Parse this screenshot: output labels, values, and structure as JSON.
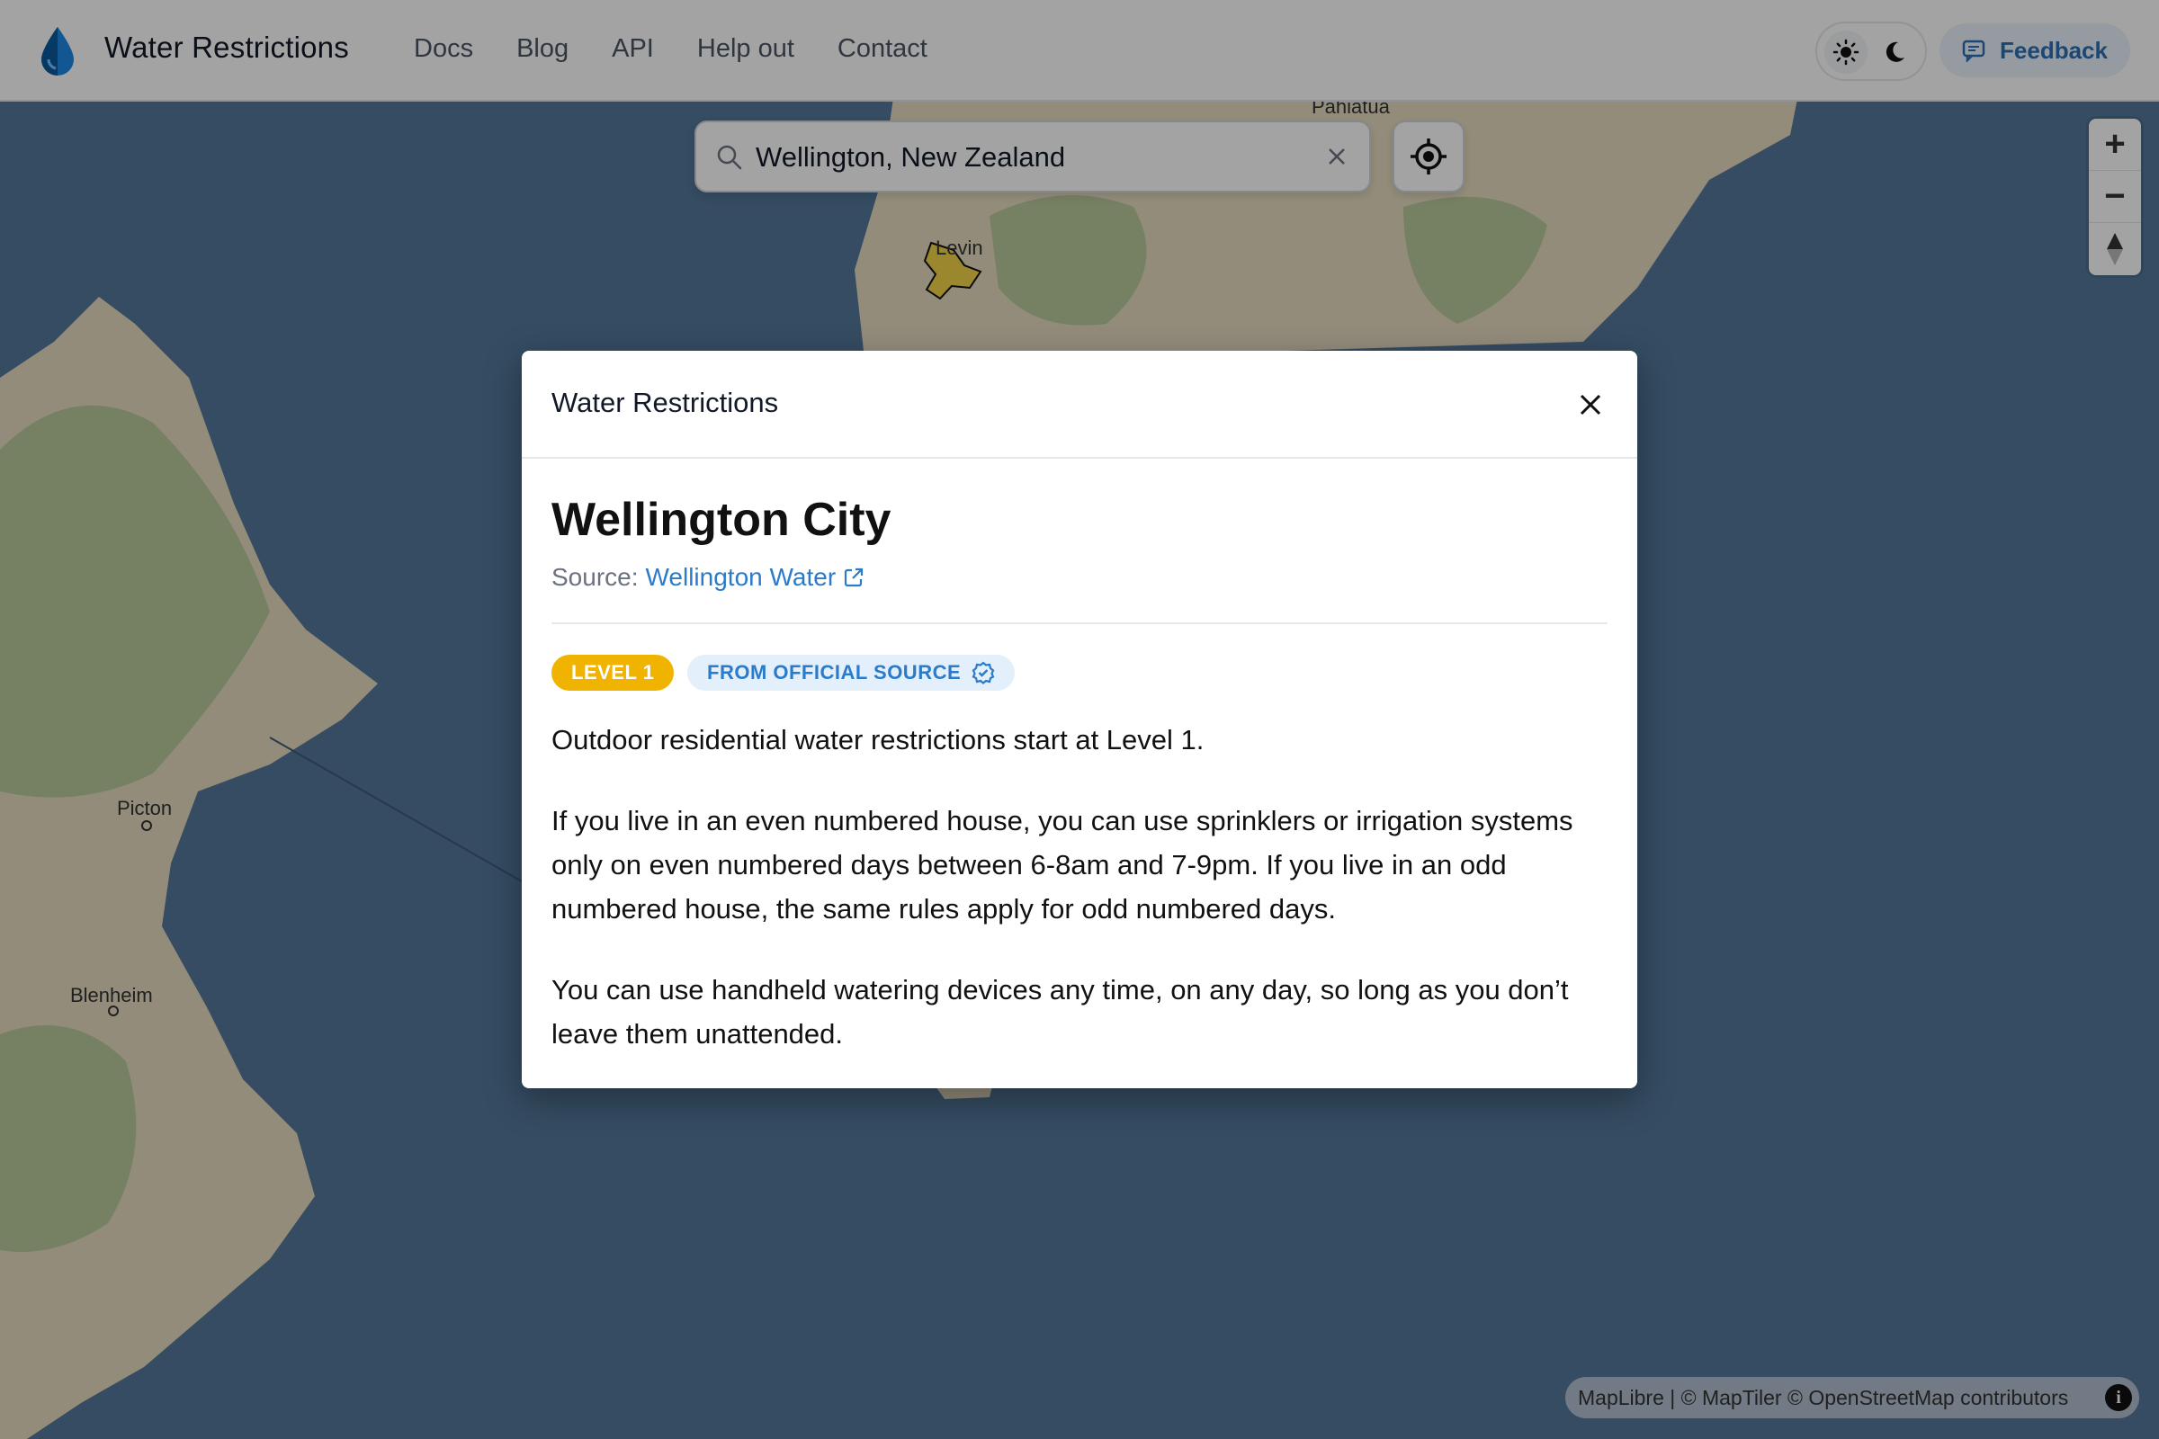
{
  "header": {
    "app_title": "Water Restrictions",
    "logo_icon": "water-drop-icon",
    "nav": [
      "Docs",
      "Blog",
      "API",
      "Help out",
      "Contact"
    ],
    "theme_icons": [
      "sun-icon",
      "moon-icon"
    ],
    "feedback_label": "Feedback",
    "feedback_icon": "chat-icon"
  },
  "search": {
    "value": "Wellington, New Zealand",
    "search_icon": "search-icon",
    "clear_icon": "close-icon",
    "locate_icon": "locate-icon"
  },
  "map": {
    "places": [
      "Pahiatua",
      "Levin",
      "Picton",
      "Blenheim"
    ],
    "zoom_in": "+",
    "zoom_out": "−",
    "attribution": "MapLibre | © MapTiler © OpenStreetMap contributors",
    "info_label": "i",
    "colors": {
      "water": "#54779a",
      "land": "#e6dcc0",
      "forest": "#b9c89a"
    }
  },
  "modal": {
    "title": "Water Restrictions",
    "area_name": "Wellington City",
    "source_label": "Source:",
    "source_link": "Wellington Water",
    "level_badge": "LEVEL 1",
    "official_badge": "FROM OFFICIAL SOURCE",
    "paragraphs": [
      "Outdoor residential water restrictions start at Level 1.",
      "If you live in an even numbered house, you can use sprinklers or irrigation systems only on even numbered days between 6-8am and 7-9pm. If you live in an odd numbered house, the same rules apply for odd numbered days.",
      "You can use handheld watering devices any time, on any day, so long as you don’t leave them unattended."
    ],
    "colors": {
      "level": "#f0b400",
      "official_bg": "#e3effb",
      "link": "#2a7bc9"
    }
  }
}
